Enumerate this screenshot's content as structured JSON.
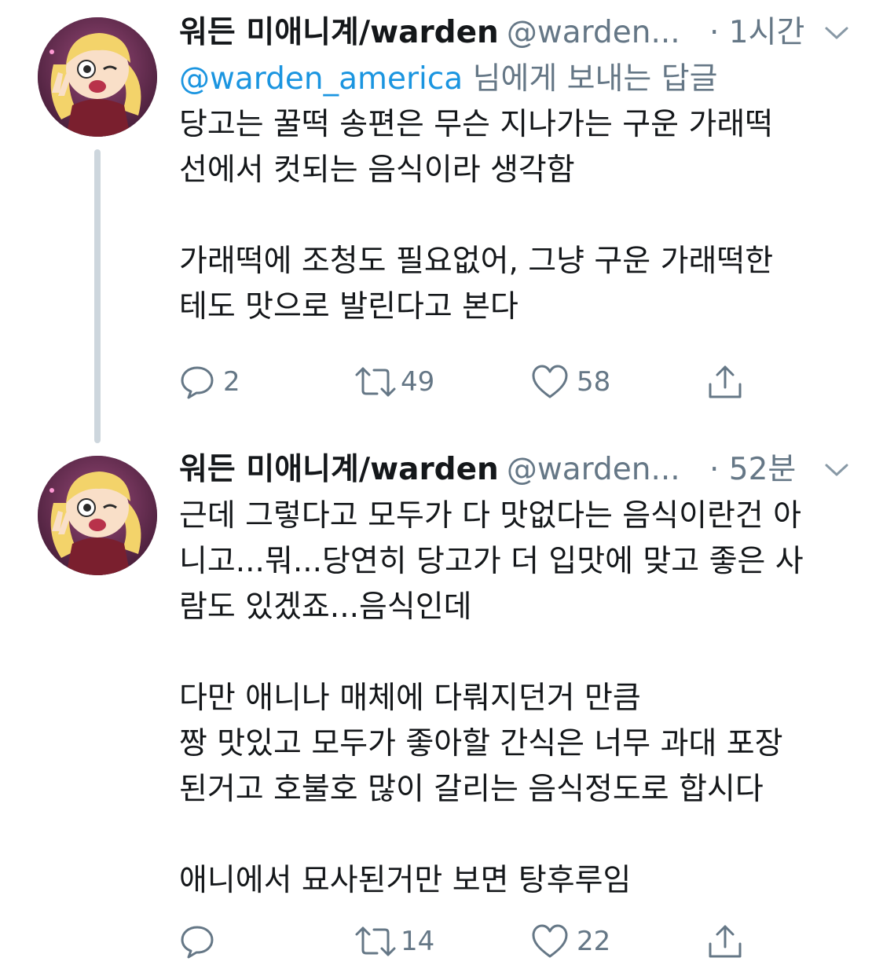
{
  "tweets": [
    {
      "display_name": "워든 미애니계/warden",
      "handle": "@warden...",
      "time": "· 1시간",
      "reply_to": {
        "mention": "@warden_america",
        "suffix": " 님에게 보내는 답글"
      },
      "lines": {
        "l1": "당고는 꿀떡 송편은 무슨 지나가는 구운 가래떡",
        "l2": "선에서 컷되는 음식이라 생각함",
        "l3": "가래떡에 조청도 필요없어, 그냥 구운 가래떡한",
        "l4": "테도 맛으로 발린다고 본다"
      },
      "actions": {
        "replies": "2",
        "retweets": "49",
        "likes": "58"
      }
    },
    {
      "display_name": "워든 미애니계/warden",
      "handle": "@warden...",
      "time": "· 52분",
      "lines": {
        "l1": "근데 그렇다고 모두가 다 맛없다는 음식이란건 아",
        "l2": "니고...뭐...당연히 당고가 더 입맛에 맞고 좋은 사",
        "l3": "람도 있겠죠...음식인데",
        "l4": "다만 애니나 매체에 다뤄지던거 만큼",
        "l5": "짱 맛있고 모두가 좋아할 간식은 너무 과대 포장",
        "l6": "된거고 호불호 많이 갈리는 음식정도로 합시다",
        "l7": "애니에서 묘사된거만 보면 탕후루임"
      },
      "actions": {
        "replies": "",
        "retweets": "14",
        "likes": "22"
      }
    }
  ],
  "colors": {
    "text": "#14171a",
    "secondary": "#657786",
    "mention": "#1b95e0",
    "thread_line": "#cdd6dd"
  },
  "icons": {
    "reply": "speech-bubble-icon",
    "retweet": "retweet-arrows-icon",
    "like": "heart-outline-icon",
    "share": "share-upload-icon",
    "menu": "chevron-down-icon"
  }
}
